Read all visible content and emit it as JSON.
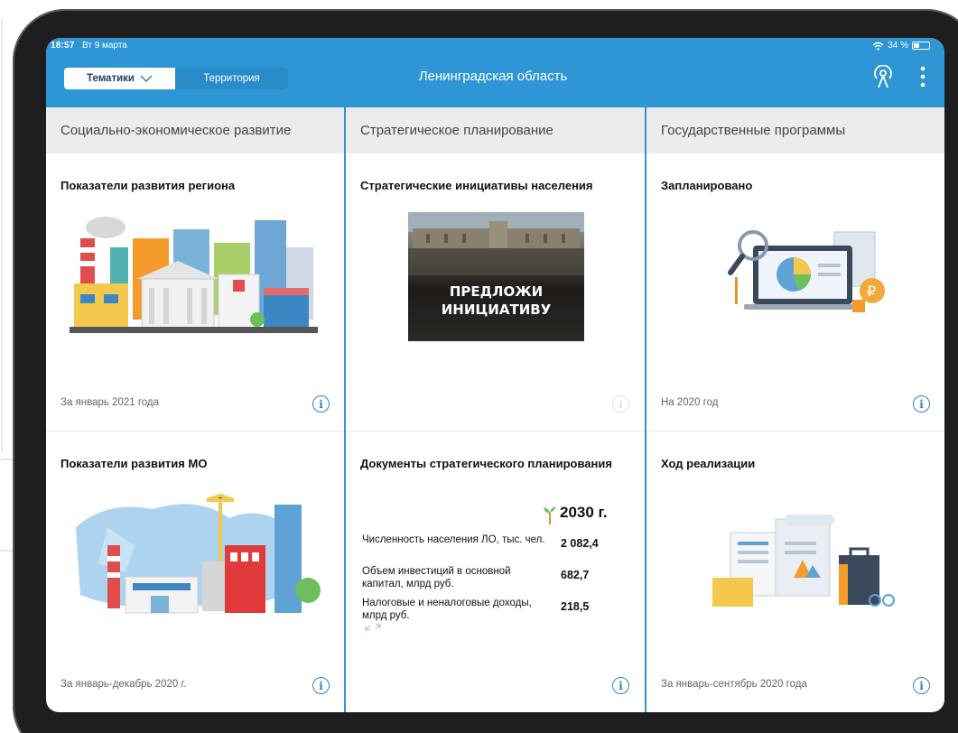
{
  "status_bar": {
    "time": "18:57",
    "date": "Вт 9 марта",
    "battery": "34 %"
  },
  "header": {
    "tab_active": "Тематики",
    "tab_inactive": "Территория",
    "title": "Ленинградская область"
  },
  "columns": [
    {
      "title": "Социально-экономическое развитие",
      "cards": [
        {
          "title": "Показатели развития региона",
          "footer": "За январь 2021 года"
        },
        {
          "title": "Показатели развития МО",
          "footer": "За январь-декабрь 2020 г."
        }
      ]
    },
    {
      "title": "Стратегическое планирование",
      "cards": [
        {
          "title": "Стратегические инициативы населения",
          "banner_line1": "ПРЕДЛОЖИ",
          "banner_line2": "ИНИЦИАТИВУ"
        },
        {
          "title": "Документы стратегического планирования",
          "year": "2030 г.",
          "rows": [
            {
              "label": "Численность населения ЛО, тыс. чел.",
              "value": "2 082,4"
            },
            {
              "label": "Объем инвестиций в основной капитал, млрд руб.",
              "value": "682,7"
            },
            {
              "label": "Налоговые и неналоговые доходы, млрд руб.",
              "value": "218,5"
            }
          ]
        }
      ]
    },
    {
      "title": "Государственные программы",
      "cards": [
        {
          "title": "Запланировано",
          "footer": "На 2020 год"
        },
        {
          "title": "Ход реализации",
          "footer": "За январь-сентябрь 2020 года"
        }
      ]
    }
  ],
  "info_icon": "i",
  "icons": [
    "wifi-icon",
    "battery-icon",
    "chevron-down-icon",
    "broadcast-icon",
    "more-vertical-icon",
    "info-icon",
    "expand-icon",
    "sprout-icon"
  ],
  "colors": {
    "header": "#2f96d6",
    "accent": "#2f80c8",
    "column_head_bg": "#ececec"
  }
}
